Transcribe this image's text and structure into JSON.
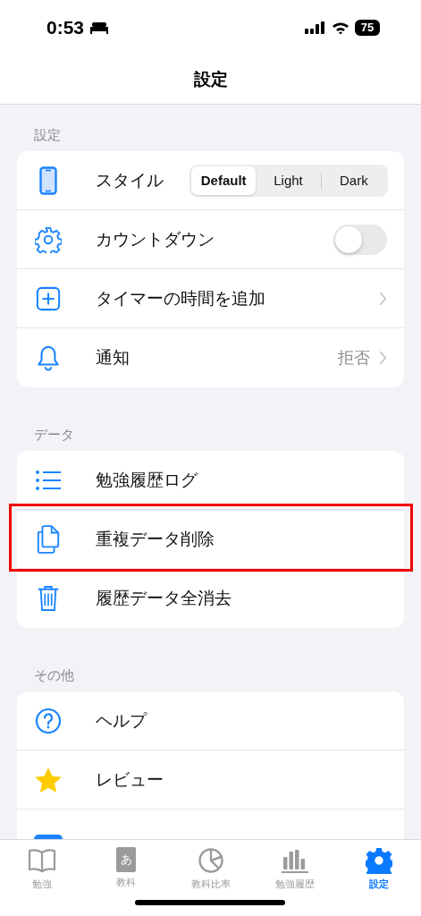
{
  "status_bar": {
    "time": "0:53",
    "battery": "75"
  },
  "nav": {
    "title": "設定"
  },
  "sections": [
    {
      "header": "設定",
      "rows": [
        {
          "kind": "segmented",
          "label": "スタイル",
          "options": [
            {
              "label": "Default",
              "selected": true
            },
            {
              "label": "Light",
              "selected": false
            },
            {
              "label": "Dark",
              "selected": false
            }
          ]
        },
        {
          "kind": "toggle",
          "label": "カウントダウン",
          "on": false
        },
        {
          "kind": "link",
          "label": "タイマーの時間を追加"
        },
        {
          "kind": "link",
          "label": "通知",
          "value": "拒否"
        }
      ]
    },
    {
      "header": "データ",
      "rows": [
        {
          "kind": "plain",
          "label": "勉強履歴ログ",
          "highlighted": false
        },
        {
          "kind": "plain",
          "label": "重複データ削除",
          "highlighted": true
        },
        {
          "kind": "plain",
          "label": "履歴データ全消去",
          "highlighted": false
        }
      ]
    },
    {
      "header": "その他",
      "rows": [
        {
          "kind": "plain",
          "label": "ヘルプ"
        },
        {
          "kind": "plain",
          "label": "レビュー"
        },
        {
          "kind": "plain"
        }
      ]
    }
  ],
  "tabs": [
    {
      "label": "勉強",
      "selected": false
    },
    {
      "glyph": "あ",
      "label": "教科",
      "selected": false
    },
    {
      "label": "教科比率",
      "selected": false
    },
    {
      "label": "勉強履歴",
      "selected": false
    },
    {
      "label": "設定",
      "selected": true
    }
  ]
}
